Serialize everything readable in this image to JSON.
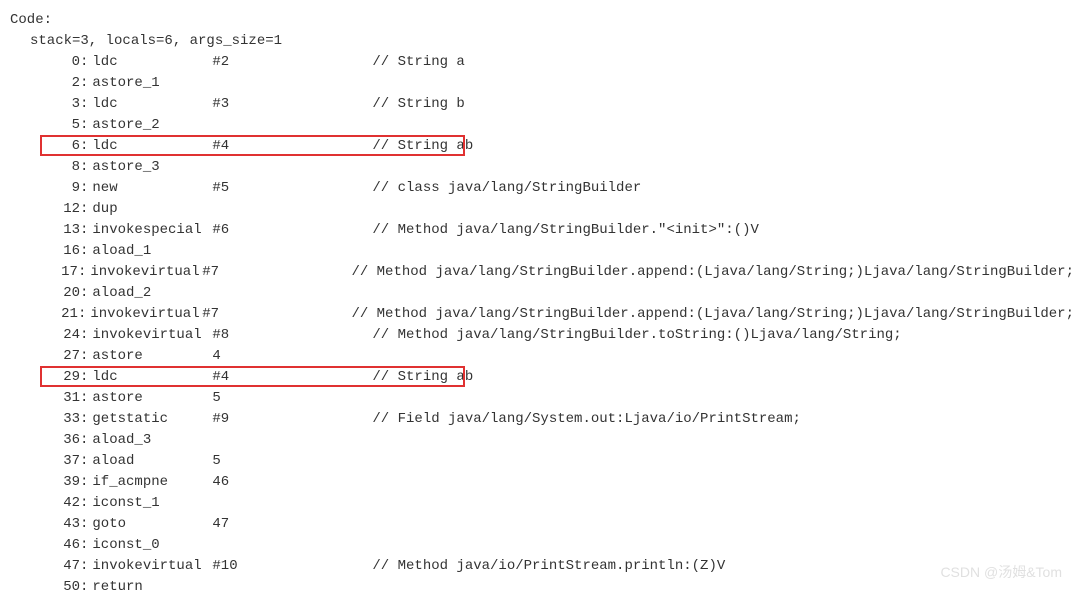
{
  "header": "Code:",
  "meta": "stack=3, locals=6, args_size=1",
  "lines": [
    {
      "no": "0",
      "op": "ldc",
      "arg": "#2",
      "comment": "// String a"
    },
    {
      "no": "2",
      "op": "astore_1",
      "arg": "",
      "comment": ""
    },
    {
      "no": "3",
      "op": "ldc",
      "arg": "#3",
      "comment": "// String b"
    },
    {
      "no": "5",
      "op": "astore_2",
      "arg": "",
      "comment": ""
    },
    {
      "no": "6",
      "op": "ldc",
      "arg": "#4",
      "comment": "// String ab"
    },
    {
      "no": "8",
      "op": "astore_3",
      "arg": "",
      "comment": ""
    },
    {
      "no": "9",
      "op": "new",
      "arg": "#5",
      "comment": "// class java/lang/StringBuilder"
    },
    {
      "no": "12",
      "op": "dup",
      "arg": "",
      "comment": ""
    },
    {
      "no": "13",
      "op": "invokespecial",
      "arg": "#6",
      "comment": "// Method java/lang/StringBuilder.\"<init>\":()V"
    },
    {
      "no": "16",
      "op": "aload_1",
      "arg": "",
      "comment": ""
    },
    {
      "no": "17",
      "op": "invokevirtual",
      "arg": "#7",
      "comment": "// Method java/lang/StringBuilder.append:(Ljava/lang/String;)Ljava/lang/StringBuilder;"
    },
    {
      "no": "20",
      "op": "aload_2",
      "arg": "",
      "comment": ""
    },
    {
      "no": "21",
      "op": "invokevirtual",
      "arg": "#7",
      "comment": "// Method java/lang/StringBuilder.append:(Ljava/lang/String;)Ljava/lang/StringBuilder;"
    },
    {
      "no": "24",
      "op": "invokevirtual",
      "arg": "#8",
      "comment": "// Method java/lang/StringBuilder.toString:()Ljava/lang/String;"
    },
    {
      "no": "27",
      "op": "astore",
      "arg": "4",
      "comment": ""
    },
    {
      "no": "29",
      "op": "ldc",
      "arg": "#4",
      "comment": "// String ab"
    },
    {
      "no": "31",
      "op": "astore",
      "arg": "5",
      "comment": ""
    },
    {
      "no": "33",
      "op": "getstatic",
      "arg": "#9",
      "comment": "// Field java/lang/System.out:Ljava/io/PrintStream;"
    },
    {
      "no": "36",
      "op": "aload_3",
      "arg": "",
      "comment": ""
    },
    {
      "no": "37",
      "op": "aload",
      "arg": "5",
      "comment": ""
    },
    {
      "no": "39",
      "op": "if_acmpne",
      "arg": "46",
      "comment": ""
    },
    {
      "no": "42",
      "op": "iconst_1",
      "arg": "",
      "comment": ""
    },
    {
      "no": "43",
      "op": "goto",
      "arg": "47",
      "comment": ""
    },
    {
      "no": "46",
      "op": "iconst_0",
      "arg": "",
      "comment": ""
    },
    {
      "no": "47",
      "op": "invokevirtual",
      "arg": "#10",
      "comment": "// Method java/io/PrintStream.println:(Z)V"
    },
    {
      "no": "50",
      "op": "return",
      "arg": "",
      "comment": ""
    }
  ],
  "watermark": "CSDN @汤姆&Tom"
}
